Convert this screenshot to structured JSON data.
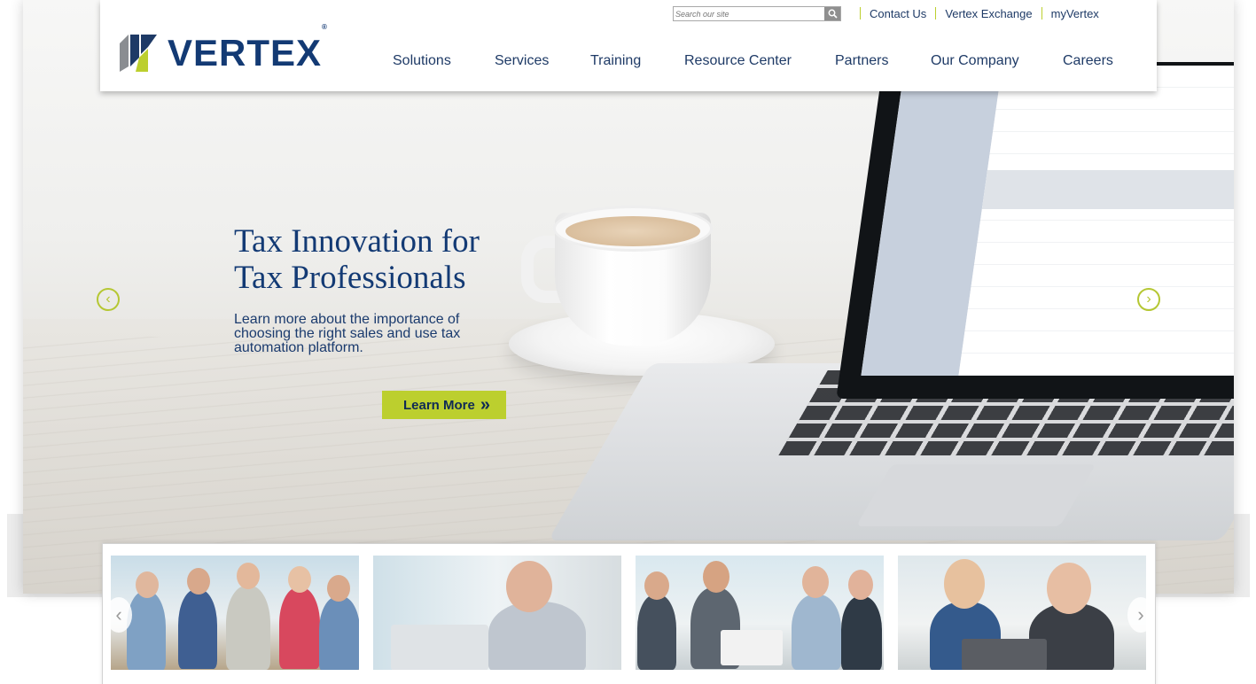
{
  "brand": {
    "name": "VERTEX",
    "reg": "®"
  },
  "search": {
    "placeholder": "Search our site"
  },
  "util_nav": [
    "Contact Us",
    "Vertex Exchange",
    "myVertex"
  ],
  "main_nav": [
    "Solutions",
    "Services",
    "Training",
    "Resource Center",
    "Partners",
    "Our Company",
    "Careers"
  ],
  "hero": {
    "title_line1": "Tax Innovation for",
    "title_line2": "Tax Professionals",
    "description": "Learn more about the importance of choosing the right sales and use tax automation platform.",
    "cta_label": "Learn More",
    "cta_icon": "»"
  },
  "carousel": {
    "prev_icon": "‹",
    "next_icon": "›"
  },
  "colors": {
    "navy": "#133a74",
    "accent_green": "#bccf2e"
  },
  "feature_strip": {
    "prev_icon": "‹",
    "next_icon": "›",
    "cards": [
      {
        "caption": ""
      },
      {
        "caption": ""
      },
      {
        "caption": ""
      },
      {
        "caption": ""
      }
    ]
  }
}
